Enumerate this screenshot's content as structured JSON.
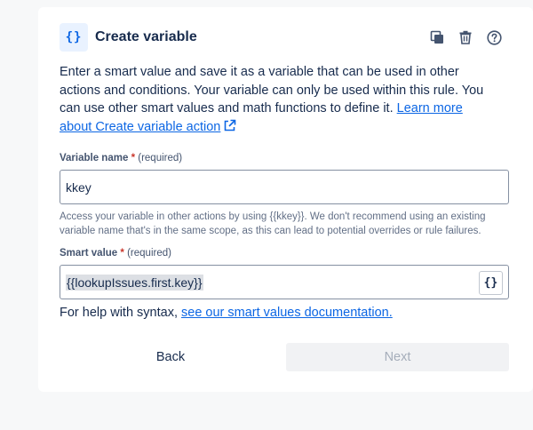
{
  "header": {
    "icon": "curly-braces-icon",
    "icon_text": "{}",
    "title": "Create variable",
    "actions": [
      "duplicate-icon",
      "trash-icon",
      "help-icon"
    ]
  },
  "description": {
    "text": "Enter a smart value and save it as a variable that can be used in other actions and conditions. Your variable can only be used within this rule. You can use other smart values and math functions to define it. ",
    "link": "Learn more about Create variable action",
    "link_icon": "external-link-icon"
  },
  "variable_name": {
    "label": "Variable name",
    "required_mark": "*",
    "optional_text": "(required)",
    "value": "kkey",
    "help": "Access your variable in other actions by using {{kkey}}. We don't recommend using an existing variable name that's in the same scope, as this can lead to potential overrides or rule failures."
  },
  "smart_value": {
    "label": "Smart value",
    "required_mark": "*",
    "optional_text": "(required)",
    "value": "{{lookupIssues.first.key}}",
    "button_text": "{}"
  },
  "syntax_help": {
    "text": "For help with syntax, ",
    "link": "see our smart values documentation."
  },
  "footer": {
    "back_label": "Back",
    "next_label": "Next"
  },
  "colors": {
    "accent": "#0c66e4",
    "required": "#c9372c"
  }
}
